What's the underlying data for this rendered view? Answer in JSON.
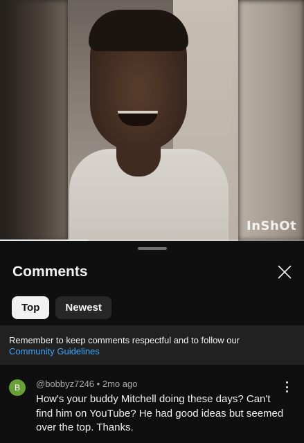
{
  "video": {
    "watermark": "InShOt",
    "progress_fraction": 0.29
  },
  "comments_panel": {
    "title": "Comments",
    "chips": [
      {
        "label": "Top",
        "selected": true
      },
      {
        "label": "Newest",
        "selected": false
      }
    ],
    "notice": {
      "text": "Remember to keep comments respectful and to follow our",
      "link": "Community Guidelines"
    },
    "comments": [
      {
        "avatar_letter": "B",
        "avatar_color": "#689f38",
        "author": "@bobbyz7246",
        "separator": "•",
        "time": "2mo ago",
        "text": "How's your buddy Mitchell doing these days? Can't find him on YouTube? He had good ideas but seemed over the top. Thanks."
      }
    ]
  },
  "colors": {
    "background": "#0f0f0f",
    "notice_background": "#212121",
    "link": "#3ea6ff"
  },
  "icons": {
    "close": "close-icon",
    "more": "more-vertical-icon"
  }
}
